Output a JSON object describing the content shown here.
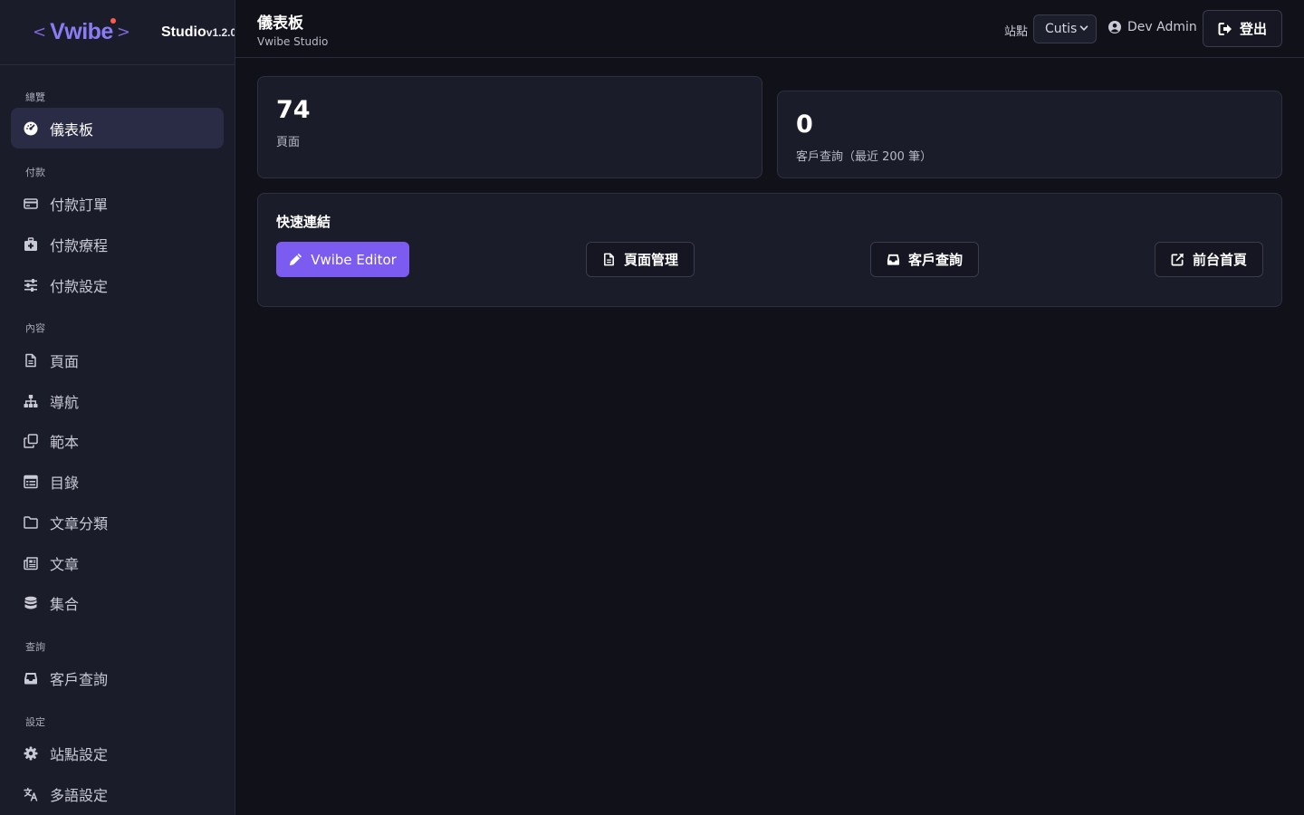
{
  "brand": {
    "bracket_left": "<",
    "name": "Vwibe",
    "bracket_right": ">",
    "product": "Studio",
    "version": "v1.2.0"
  },
  "sidebar": {
    "sections": [
      {
        "label": "總覽",
        "items": [
          {
            "label": "儀表板",
            "icon": "dashboard-icon",
            "active": true
          }
        ]
      },
      {
        "label": "付款",
        "items": [
          {
            "label": "付款訂單",
            "icon": "credit-card-icon"
          },
          {
            "label": "付款療程",
            "icon": "briefcase-medical-icon"
          },
          {
            "label": "付款設定",
            "icon": "sliders-icon"
          }
        ]
      },
      {
        "label": "內容",
        "items": [
          {
            "label": "頁面",
            "icon": "file-icon"
          },
          {
            "label": "導航",
            "icon": "sitemap-icon"
          },
          {
            "label": "範本",
            "icon": "clone-icon"
          },
          {
            "label": "目錄",
            "icon": "table-list-icon"
          },
          {
            "label": "文章分類",
            "icon": "folder-icon"
          },
          {
            "label": "文章",
            "icon": "newspaper-icon"
          },
          {
            "label": "集合",
            "icon": "database-icon"
          }
        ]
      },
      {
        "label": "查詢",
        "items": [
          {
            "label": "客戶查詢",
            "icon": "inbox-icon"
          }
        ]
      },
      {
        "label": "設定",
        "items": [
          {
            "label": "站點設定",
            "icon": "gear-icon"
          },
          {
            "label": "多語設定",
            "icon": "language-icon"
          }
        ]
      }
    ]
  },
  "header": {
    "title": "儀表板",
    "subtitle": "Vwibe Studio",
    "site_label": "站點",
    "site_value": "Cutis",
    "user_name": "Dev Admin",
    "logout_label": "登出"
  },
  "stats": [
    {
      "value": "74",
      "label": "頁面"
    },
    {
      "value": "0",
      "label": "客戶查詢（最近 200 筆）"
    }
  ],
  "quick_links": {
    "title": "快速連結",
    "items": [
      {
        "label": "Vwibe Editor",
        "icon": "pen-icon",
        "style": "primary"
      },
      {
        "label": "頁面管理",
        "icon": "file-icon",
        "style": "outline"
      },
      {
        "label": "客戶查詢",
        "icon": "inbox-icon",
        "style": "outline"
      },
      {
        "label": "前台首頁",
        "icon": "external-link-icon",
        "style": "outline"
      }
    ]
  },
  "colors": {
    "accent": "#7c5cf0",
    "background": "#111119",
    "surface": "#1b1c29"
  }
}
